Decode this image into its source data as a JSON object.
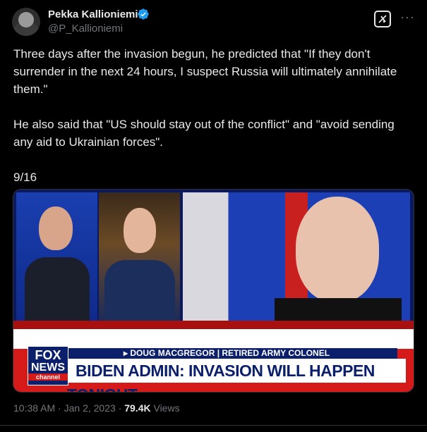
{
  "author": {
    "name": "Pekka Kallioniemi",
    "handle": "@P_Kallioniemi"
  },
  "tweet": {
    "text": "Three days after the invasion begun, he predicted that \"If they don't surrender in the next 24 hours, I suspect Russia will ultimately annihilate them.\"\n\nHe also said that \"US should stay out of the conflict\" and \"avoid sending any aid to Ukrainian forces\".\n\n9/16"
  },
  "media": {
    "chyron_top": "▸ DOUG MACGREGOR | RETIRED ARMY COLONEL",
    "chyron_main": "BIDEN ADMIN: INVASION WILL HAPPEN TONIGHT",
    "logo_fox": "FOX",
    "logo_news": "NEWS",
    "logo_channel": "channel"
  },
  "meta": {
    "time": "10:38 AM",
    "date": "Jan 2, 2023",
    "views_count": "79.4K",
    "views_label": "Views"
  },
  "colors": {
    "verified": "#1d9bf0",
    "fox_blue": "#0b1f6b",
    "fox_red": "#d61a1a"
  },
  "icons": [
    "verified-badge-icon",
    "grok-icon",
    "more-icon"
  ]
}
